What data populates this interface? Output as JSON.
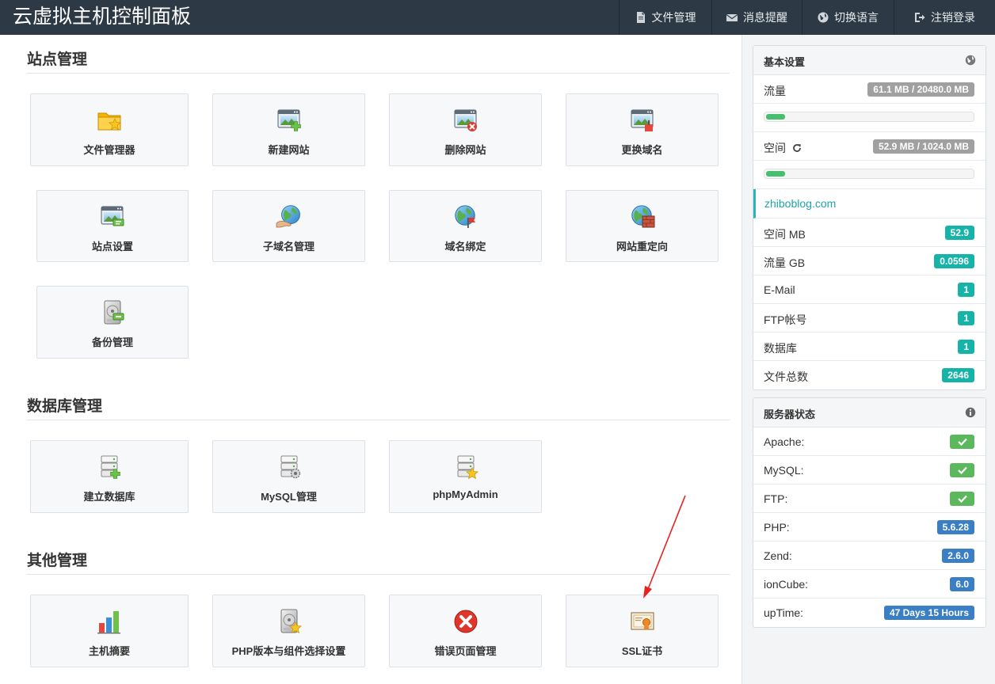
{
  "header": {
    "title": "云虚拟主机控制面板",
    "nav": [
      {
        "label": "文件管理",
        "icon": "file-icon"
      },
      {
        "label": "消息提醒",
        "icon": "envelope-icon"
      },
      {
        "label": "切换语言",
        "icon": "globe-icon"
      },
      {
        "label": "注销登录",
        "icon": "sign-out-icon"
      }
    ]
  },
  "sections": {
    "site": {
      "title": "站点管理",
      "tiles": [
        {
          "label": "文件管理器",
          "icon": "folder-star-icon"
        },
        {
          "label": "新建网站",
          "icon": "website-add-icon"
        },
        {
          "label": "删除网站",
          "icon": "website-delete-icon"
        },
        {
          "label": "更换域名",
          "icon": "website-change-icon"
        },
        {
          "label": "站点设置",
          "icon": "website-settings-icon"
        },
        {
          "label": "子域名管理",
          "icon": "globe-hand-icon"
        },
        {
          "label": "域名绑定",
          "icon": "globe-flag-icon"
        },
        {
          "label": "网站重定向",
          "icon": "globe-wall-icon"
        },
        {
          "label": "备份管理",
          "icon": "disk-backup-icon"
        }
      ]
    },
    "db": {
      "title": "数据库管理",
      "tiles": [
        {
          "label": "建立数据库",
          "icon": "database-add-icon"
        },
        {
          "label": "MySQL管理",
          "icon": "database-gear-icon"
        },
        {
          "label": "phpMyAdmin",
          "icon": "database-star-icon"
        }
      ]
    },
    "other": {
      "title": "其他管理",
      "tiles": [
        {
          "label": "主机摘要",
          "icon": "bar-chart-icon"
        },
        {
          "label": "PHP版本与组件选择设置",
          "icon": "disk-star-icon"
        },
        {
          "label": "错误页面管理",
          "icon": "error-icon"
        },
        {
          "label": "SSL证书",
          "icon": "certificate-icon"
        }
      ]
    }
  },
  "basic": {
    "title": "基本设置",
    "traffic": {
      "label": "流量",
      "value": "61.1 MB / 20480.0 MB",
      "fraction": 0.003
    },
    "space": {
      "label": "空间",
      "value": "52.9 MB / 1024.0 MB",
      "fraction": 0.052
    },
    "domain": "zhiboblog.com",
    "stats": [
      {
        "label": "空间 MB",
        "value": "52.9"
      },
      {
        "label": "流量 GB",
        "value": "0.0596"
      },
      {
        "label": "E-Mail",
        "value": "1"
      },
      {
        "label": "FTP帐号",
        "value": "1"
      },
      {
        "label": "数据库",
        "value": "1"
      },
      {
        "label": "文件总数",
        "value": "2646"
      }
    ]
  },
  "server": {
    "title": "服务器状态",
    "rows": [
      {
        "label": "Apache:",
        "ok": true
      },
      {
        "label": "MySQL:",
        "ok": true
      },
      {
        "label": "FTP:",
        "ok": true
      },
      {
        "label": "PHP:",
        "value": "5.6.28"
      },
      {
        "label": "Zend:",
        "value": "2.6.0"
      },
      {
        "label": "ionCube:",
        "value": "6.0"
      },
      {
        "label": "upTime:",
        "value": "47 Days 15 Hours"
      }
    ]
  },
  "colors": {
    "topbar": "#2d3a46",
    "teal": "#16b4a8",
    "green": "#5cb85c",
    "blue": "#3a7ec4",
    "annotation_arrow": "#e8201e"
  }
}
